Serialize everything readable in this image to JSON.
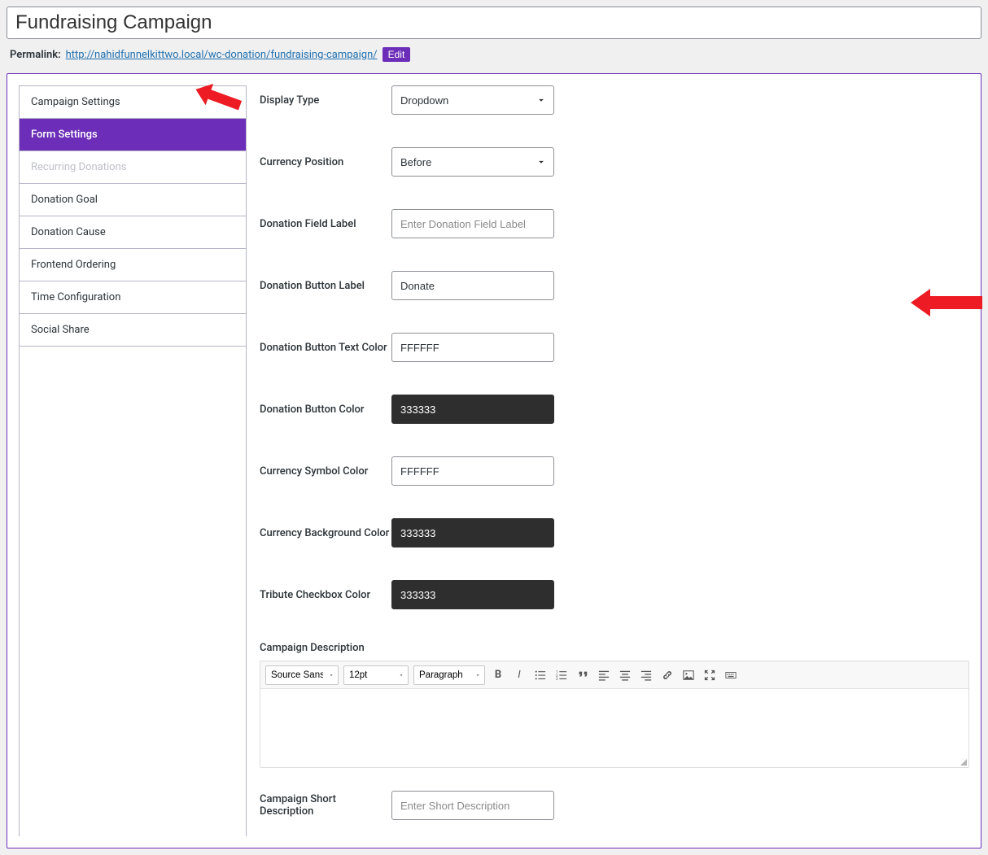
{
  "title": "Fundraising Campaign",
  "permalink": {
    "label": "Permalink:",
    "url": "http://nahidfunnelkittwo.local/wc-donation/fundraising-campaign/",
    "edit": "Edit"
  },
  "sidebar": {
    "items": [
      {
        "label": "Campaign Settings",
        "active": false,
        "disabled": false
      },
      {
        "label": "Form Settings",
        "active": true,
        "disabled": false
      },
      {
        "label": "Recurring Donations",
        "active": false,
        "disabled": true
      },
      {
        "label": "Donation Goal",
        "active": false,
        "disabled": false
      },
      {
        "label": "Donation Cause",
        "active": false,
        "disabled": false
      },
      {
        "label": "Frontend Ordering",
        "active": false,
        "disabled": false
      },
      {
        "label": "Time Configuration",
        "active": false,
        "disabled": false
      },
      {
        "label": "Social Share",
        "active": false,
        "disabled": false
      }
    ]
  },
  "form": {
    "display_type": {
      "label": "Display Type",
      "value": "Dropdown"
    },
    "currency_position": {
      "label": "Currency Position",
      "value": "Before"
    },
    "donation_field_label": {
      "label": "Donation Field Label",
      "placeholder": "Enter Donation Field Label",
      "value": ""
    },
    "donation_button_label": {
      "label": "Donation Button Label",
      "value": "Donate"
    },
    "donation_button_text_color": {
      "label": "Donation Button Text Color",
      "value": "FFFFFF"
    },
    "donation_button_color": {
      "label": "Donation Button Color",
      "value": "333333"
    },
    "currency_symbol_color": {
      "label": "Currency Symbol Color",
      "value": "FFFFFF"
    },
    "currency_bg_color": {
      "label": "Currency Background Color",
      "value": "333333"
    },
    "tribute_checkbox_color": {
      "label": "Tribute Checkbox Color",
      "value": "333333"
    },
    "campaign_description": {
      "label": "Campaign Description"
    },
    "short_description": {
      "label": "Campaign Short Description",
      "placeholder": "Enter Short Description",
      "value": ""
    }
  },
  "editor": {
    "font": "Source Sans...",
    "size": "12pt",
    "para": "Paragraph"
  }
}
